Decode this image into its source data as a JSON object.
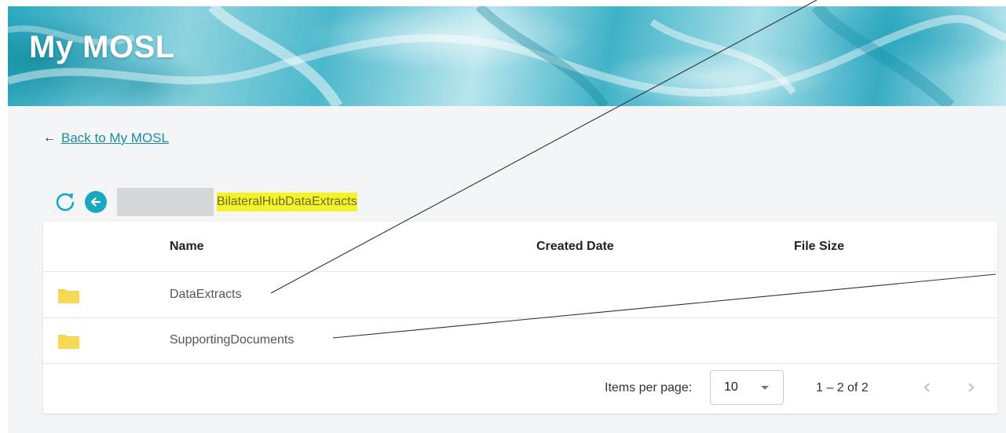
{
  "header": {
    "title": "My MOSL"
  },
  "nav": {
    "back_link": "Back to My MOSL"
  },
  "toolbar": {
    "breadcrumb": "BilateralHubDataExtracts"
  },
  "table": {
    "columns": [
      "Name",
      "Created Date",
      "File Size"
    ],
    "rows": [
      {
        "name": "DataExtracts",
        "icon": "folder-icon"
      },
      {
        "name": "SupportingDocuments",
        "icon": "folder-icon"
      }
    ]
  },
  "paginator": {
    "items_per_page_label": "Items per page:",
    "items_per_page_value": "10",
    "range_label": "1 – 2 of 2"
  },
  "colors": {
    "accent": "#1aa7c0",
    "link": "#1b8f9e",
    "folder": "#f2d44a",
    "highlight": "#f4f32a"
  }
}
